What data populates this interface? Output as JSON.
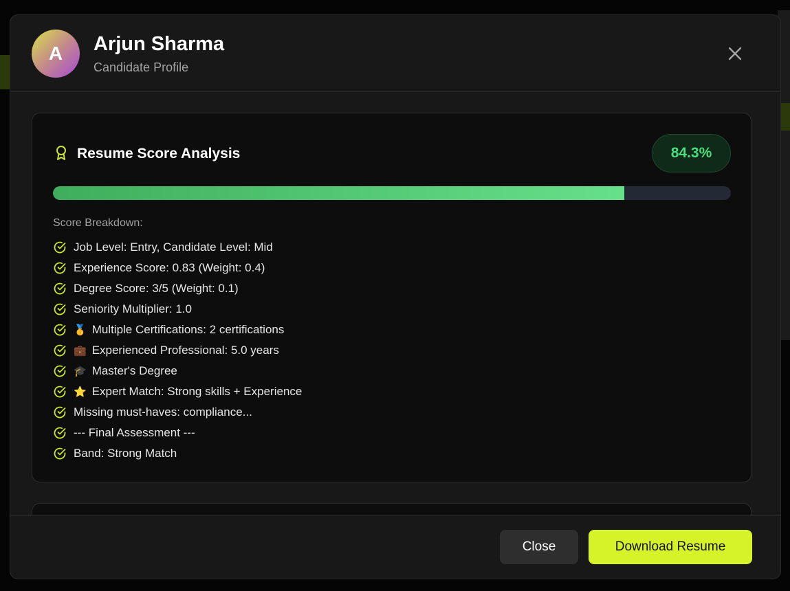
{
  "candidate": {
    "initial": "A",
    "name": "Arjun Sharma",
    "subtitle": "Candidate Profile"
  },
  "score_card": {
    "title": "Resume Score Analysis",
    "score_text": "84.3%",
    "score_value": 84.3,
    "breakdown_label": "Score Breakdown:",
    "items": [
      {
        "emoji": "",
        "text": "Job Level: Entry, Candidate Level: Mid"
      },
      {
        "emoji": "",
        "text": "Experience Score: 0.83 (Weight: 0.4)"
      },
      {
        "emoji": "",
        "text": "Degree Score: 3/5 (Weight: 0.1)"
      },
      {
        "emoji": "",
        "text": "Seniority Multiplier: 1.0"
      },
      {
        "emoji": "🥇",
        "text": "Multiple Certifications: 2 certifications"
      },
      {
        "emoji": "💼",
        "text": "Experienced Professional: 5.0 years"
      },
      {
        "emoji": "🎓",
        "text": "Master's Degree"
      },
      {
        "emoji": "⭐",
        "text": "Expert Match: Strong skills + Experience"
      },
      {
        "emoji": "",
        "text": "Missing must-haves: compliance..."
      },
      {
        "emoji": "",
        "text": "--- Final Assessment ---"
      },
      {
        "emoji": "",
        "text": "Band: Strong Match"
      }
    ]
  },
  "footer": {
    "close_label": "Close",
    "download_label": "Download Resume"
  },
  "icons": {
    "award": "award-icon",
    "check": "check-circle-icon",
    "close": "close-icon"
  },
  "colors": {
    "accent": "#d6f229",
    "score_green": "#4ade80",
    "check_yellow": "#c8e632"
  }
}
